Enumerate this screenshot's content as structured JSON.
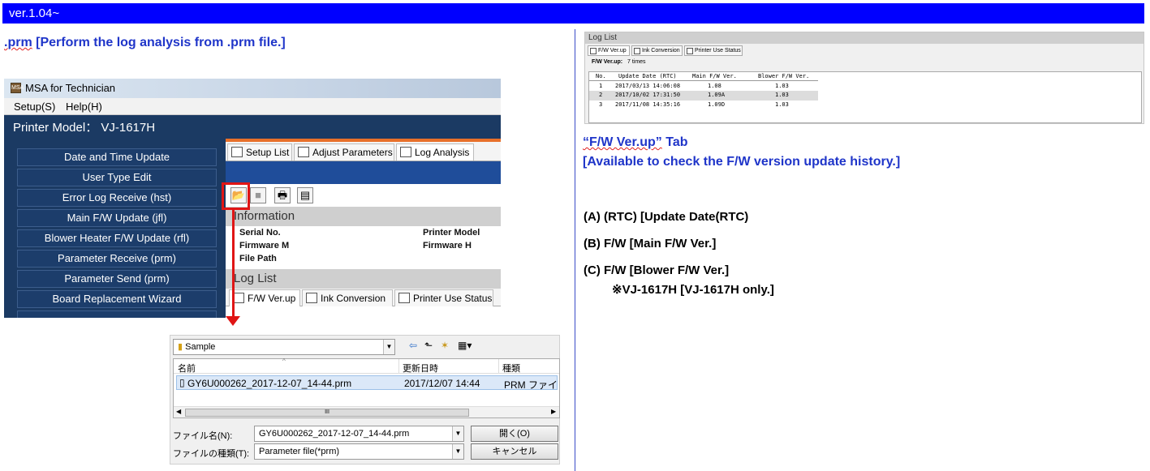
{
  "version_label": "ver.1.04~",
  "heading": {
    "prefix": ".prm",
    "bracket": "[Perform the log analysis from .prm file.]"
  },
  "msa": {
    "title": "MSA for Technician",
    "app_icon_text": "MSA",
    "menu": [
      "Setup(S)",
      "Help(H)"
    ],
    "printer_model": "Printer Model： VJ-1617H",
    "sidebar": [
      "Date and Time Update",
      "User Type Edit",
      "Error Log Receive (hst)",
      "Main F/W Update (jfl)",
      "Blower Heater F/W Update (rfl)",
      "Parameter Receive (prm)",
      "Parameter Send (prm)",
      "Board Replacement Wizard"
    ],
    "tabs": [
      "Setup List",
      "Adjust Parameters",
      "Log Analysis"
    ],
    "information_title": "Information",
    "info_labels": {
      "serial": "Serial No.",
      "firmware_m": "Firmware M",
      "file_path": "File Path",
      "printer_model": "Printer Model",
      "firmware_h": "Firmware H"
    },
    "loglist_title": "Log List",
    "loglist_tabs": [
      "F/W Ver.up",
      "Ink Conversion",
      "Printer Use Status"
    ]
  },
  "file_dialog": {
    "folder": "Sample",
    "columns": [
      "名前",
      "更新日時",
      "種類"
    ],
    "files": [
      {
        "name": "GY6U000262_2017-12-07_14-44.prm",
        "date": "2017/12/07 14:44",
        "type": "PRM ファイル"
      }
    ],
    "filename_label": "ファイル名(N):",
    "filename_value": "GY6U000262_2017-12-07_14-44.prm",
    "filetype_label": "ファイルの種類(T):",
    "filetype_value": "Parameter file(*prm)",
    "open_button": "開く(O)",
    "cancel_button": "キャンセル",
    "scroll_mark": "III"
  },
  "log_list_shot": {
    "title": "Log List",
    "tabs": [
      "F/W Ver.up",
      "Ink Conversion",
      "Printer Use Status"
    ],
    "fw_label": "F/W Ver.up:",
    "fw_count": "7 times",
    "columns": [
      "No.",
      "Update Date (RTC)",
      "Main F/W Ver.",
      "Blower F/W Ver."
    ],
    "rows": [
      [
        "1",
        "2017/03/13 14:06:08",
        "1.08",
        "1.03"
      ],
      [
        "2",
        "2017/10/02 17:31:50",
        "1.09A",
        "1.03"
      ],
      [
        "3",
        "2017/11/08 14:35:16",
        "1.09D",
        "1.03"
      ]
    ]
  },
  "right_text": {
    "tab_title_a": "“F/W Ver.up”",
    "tab_title_b": " Tab",
    "desc": "[Available to check the F/W version update history.]",
    "item_a": "(A)  (RTC) [Update Date(RTC)",
    "item_b": "(B)  F/W [Main F/W Ver.]",
    "item_c": "(C)  F/W [Blower F/W Ver.]",
    "item_c_note": "※VJ-1617H [VJ-1617H only.]"
  }
}
